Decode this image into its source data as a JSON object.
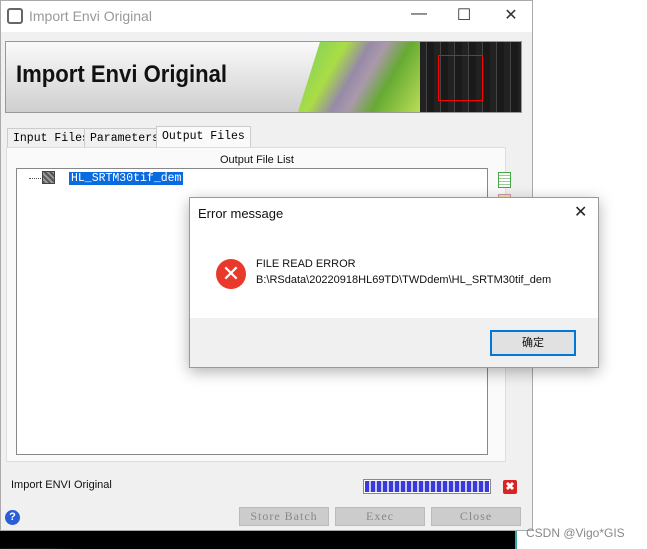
{
  "window": {
    "title": "Import Envi Original",
    "banner_title": "Import Envi Original",
    "controls": {
      "minimize": "—",
      "maximize": "☐",
      "close": "✕"
    }
  },
  "tabs": [
    {
      "label": "Input Files"
    },
    {
      "label": "Parameters"
    },
    {
      "label": "Output Files",
      "selected": true
    }
  ],
  "output": {
    "list_label": "Output File List",
    "items": [
      {
        "label": "HL_SRTM30tif_dem",
        "selected": true
      }
    ]
  },
  "status": {
    "text": "Import ENVI Original",
    "progress_percent": 100,
    "stop_glyph": "✖"
  },
  "buttons": {
    "help": "?",
    "store_batch": "Store Batch",
    "exec": "Exec",
    "close": "Close"
  },
  "dialog": {
    "title": "Error message",
    "close": "✕",
    "icon": "error-icon",
    "line1": "FILE READ ERROR",
    "line2": "B:\\RSdata\\20220918HL69TD\\TWDdem\\HL_SRTM30tif_dem",
    "ok": "确定"
  },
  "watermark": "CSDN @Vigo*GIS",
  "colors": {
    "selection": "#0a6be0",
    "error": "#e8392a",
    "focus": "#0078d7"
  }
}
